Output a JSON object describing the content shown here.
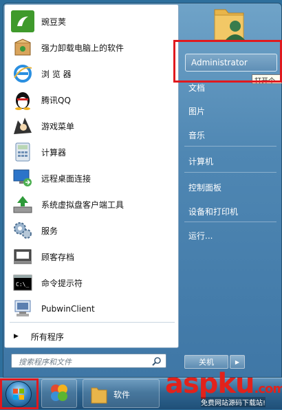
{
  "programs": [
    {
      "label": "豌豆荚",
      "icon": "wandoujia-icon",
      "color": "#3f9a2c"
    },
    {
      "label": "强力卸载电脑上的软件",
      "icon": "uninstall-box-icon",
      "color": "#d77a2a"
    },
    {
      "label": "浏 览 器",
      "icon": "ie-browser-icon",
      "color": "#2a8fe0"
    },
    {
      "label": "腾讯QQ",
      "icon": "qq-penguin-icon",
      "color": "#111111"
    },
    {
      "label": "游戏菜单",
      "icon": "game-menu-icon",
      "color": "#444444"
    },
    {
      "label": "计算器",
      "icon": "calculator-icon",
      "color": "#6e8fb5"
    },
    {
      "label": "远程桌面连接",
      "icon": "remote-desktop-icon",
      "color": "#2b74c9"
    },
    {
      "label": "系统虚拟盘客户端工具",
      "icon": "virtual-disk-icon",
      "color": "#2e9a3a"
    },
    {
      "label": "服务",
      "icon": "services-gears-icon",
      "color": "#6d8fb0"
    },
    {
      "label": "顾客存档",
      "icon": "customer-archive-icon",
      "color": "#555555"
    },
    {
      "label": "命令提示符",
      "icon": "command-prompt-icon",
      "color": "#000000"
    },
    {
      "label": "PubwinClient",
      "icon": "pubwin-client-icon",
      "color": "#5b7fb0"
    }
  ],
  "all_programs": {
    "label": "所有程序"
  },
  "search": {
    "placeholder": "搜索程序和文件"
  },
  "right": {
    "user": "Administrator",
    "items": [
      "文档",
      "图片",
      "音乐",
      "计算机",
      "控制面板",
      "设备和打印机",
      "运行..."
    ],
    "tooltip": "打开个"
  },
  "shutdown": {
    "label": "关机"
  },
  "taskbar": {
    "folder_label": "软件"
  },
  "watermark": {
    "brand": "aspku",
    "tld": ".com",
    "sub": "免费网站源码下载站!"
  }
}
